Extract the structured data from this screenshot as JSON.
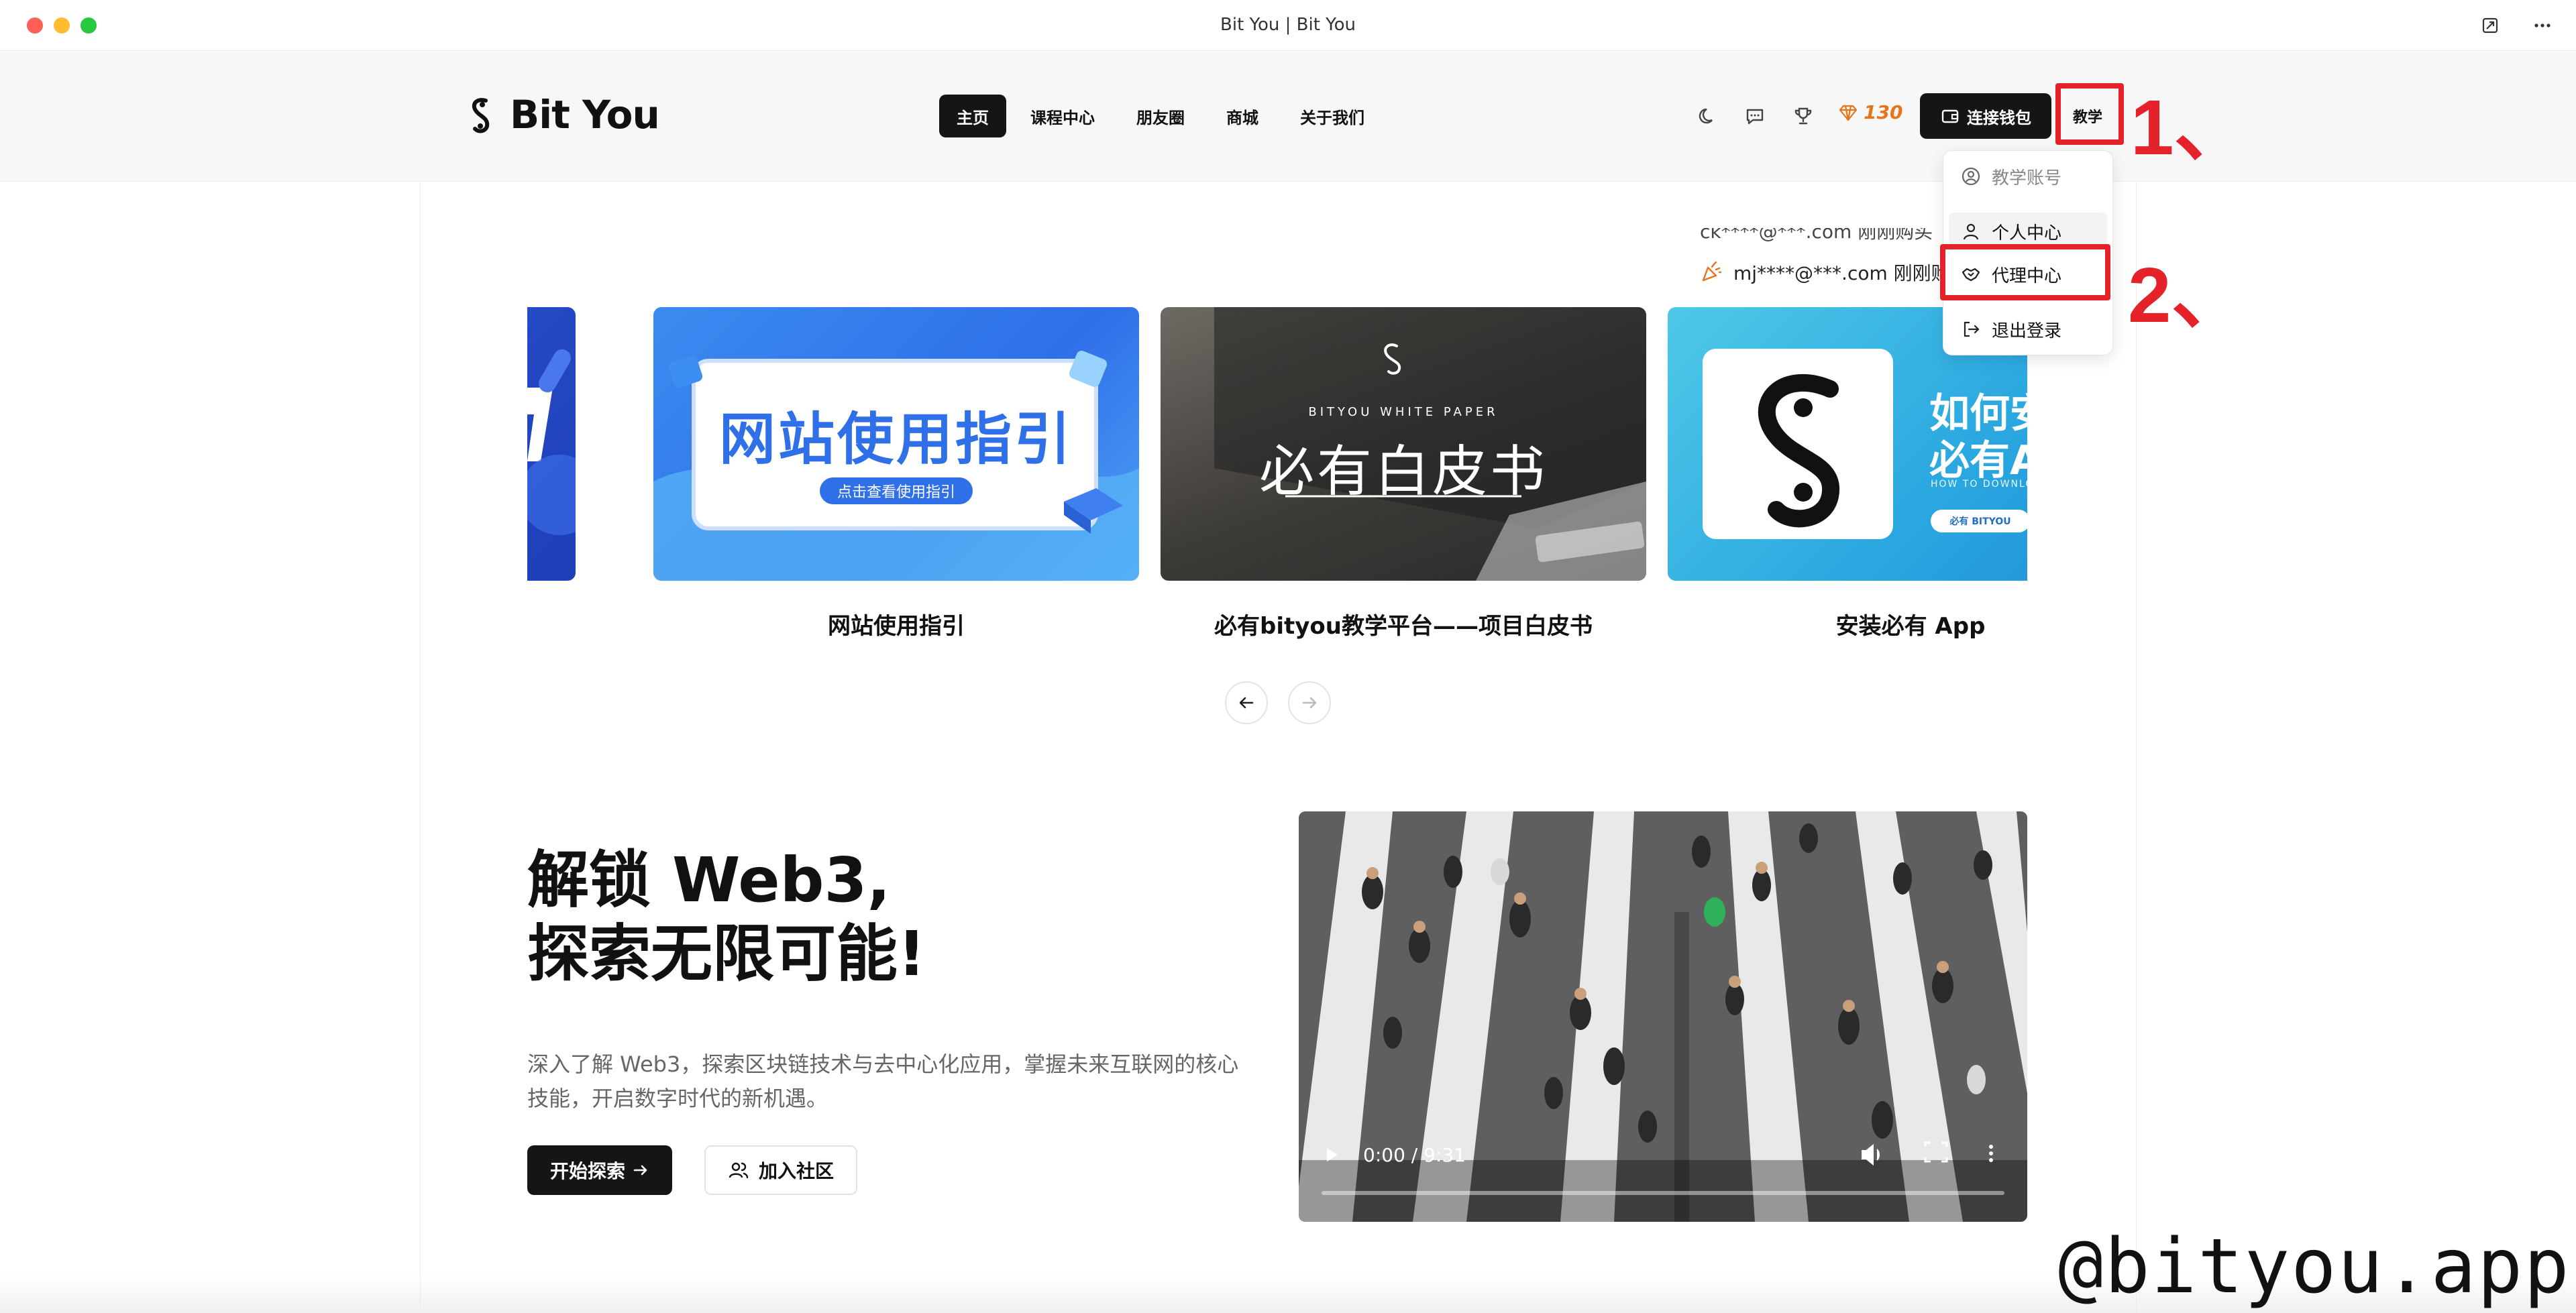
{
  "window": {
    "title": "Bit You | Bit You"
  },
  "header": {
    "logo_text": "Bit You",
    "nav": [
      {
        "label": "主页",
        "active": true
      },
      {
        "label": "课程中心",
        "active": false
      },
      {
        "label": "朋友圈",
        "active": false
      },
      {
        "label": "商城",
        "active": false
      },
      {
        "label": "关于我们",
        "active": false
      }
    ],
    "points": "130",
    "wallet_label": "连接钱包",
    "teach_label": "教学"
  },
  "annotations": {
    "step1": "1、",
    "step2": "2、"
  },
  "dropdown": {
    "items": [
      {
        "label": "教学账号",
        "icon": "user-circle-icon"
      },
      {
        "label": "个人中心",
        "icon": "user-icon"
      },
      {
        "label": "代理中心",
        "icon": "handshake-icon"
      },
      {
        "label": "退出登录",
        "icon": "logout-icon"
      }
    ]
  },
  "ticker": {
    "line": "mj****@***.com 刚刚购买",
    "partial": "ck****@***.com 刚刚购买"
  },
  "carousel": {
    "cards": [
      {
        "caption": "网站使用指引",
        "banner_title": "网站使用指引",
        "banner_sub": "点击查看使用指引"
      },
      {
        "caption": "必有bityou教学平台——项目白皮书",
        "banner_brand": "BITYOU WHITE PAPER",
        "banner_title": "必有白皮书"
      },
      {
        "caption": "安装必有 App",
        "banner_title": "如何安装",
        "banner_line2": "必有App",
        "banner_small": "HOW TO DOWNLOAD BITYOU",
        "banner_btn": "必有 BITYOU"
      }
    ]
  },
  "hero": {
    "line1": "解锁 Web3,",
    "line2": "探索无限可能!",
    "desc": "深入了解 Web3，探索区块链技术与去中心化应用，掌握未来互联网的核心技能，开启数字时代的新机遇。",
    "primary": "开始探索",
    "secondary": "加入社区"
  },
  "video": {
    "time": "0:00 / 9:31"
  },
  "watermark": "@bityou.app"
}
